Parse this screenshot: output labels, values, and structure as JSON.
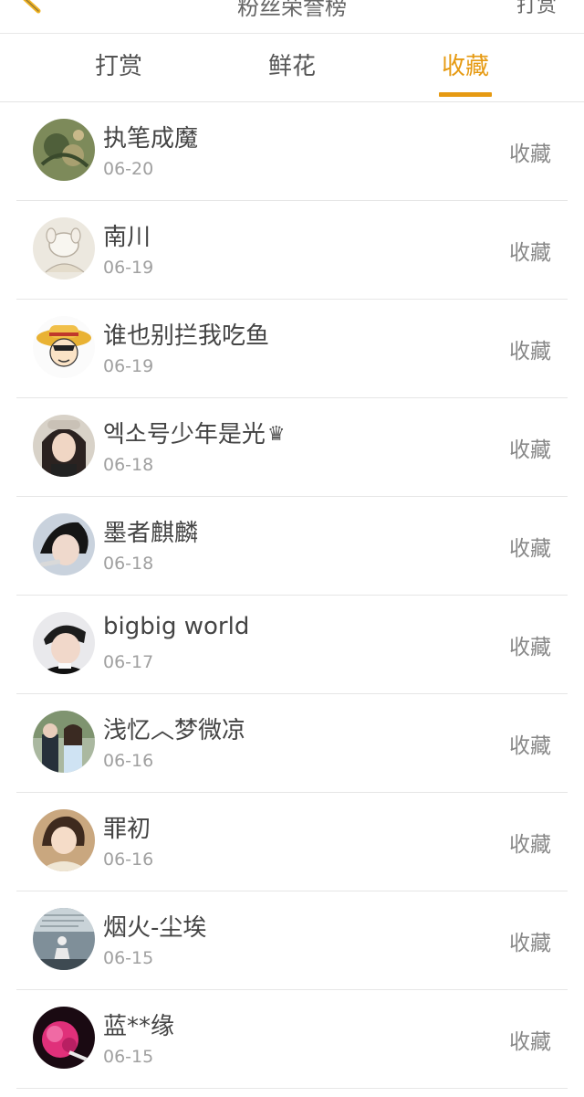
{
  "header": {
    "title": "粉丝荣誉榜",
    "right_action": "打赏"
  },
  "tabs": [
    {
      "label": "打赏"
    },
    {
      "label": "鲜花"
    },
    {
      "label": "收藏"
    }
  ],
  "active_tab": "收藏",
  "accent_color": "#e69a12",
  "items": [
    {
      "name": "执笔成魔",
      "date": "06-20",
      "action": "收藏",
      "suffix": ""
    },
    {
      "name": "南川",
      "date": "06-19",
      "action": "收藏",
      "suffix": ""
    },
    {
      "name": "谁也别拦我吃鱼",
      "date": "06-19",
      "action": "收藏",
      "suffix": ""
    },
    {
      "name": "엑소号少年是光",
      "date": "06-18",
      "action": "收藏",
      "suffix": "♛"
    },
    {
      "name": "墨者麒麟",
      "date": "06-18",
      "action": "收藏",
      "suffix": ""
    },
    {
      "name": "bigbig world",
      "date": "06-17",
      "action": "收藏",
      "suffix": ""
    },
    {
      "name": "浅忆︿梦微凉",
      "date": "06-16",
      "action": "收藏",
      "suffix": ""
    },
    {
      "name": "罪初",
      "date": "06-16",
      "action": "收藏",
      "suffix": ""
    },
    {
      "name": "烟火-尘埃",
      "date": "06-15",
      "action": "收藏",
      "suffix": ""
    },
    {
      "name": "蓝**缘",
      "date": "06-15",
      "action": "收藏",
      "suffix": ""
    }
  ]
}
